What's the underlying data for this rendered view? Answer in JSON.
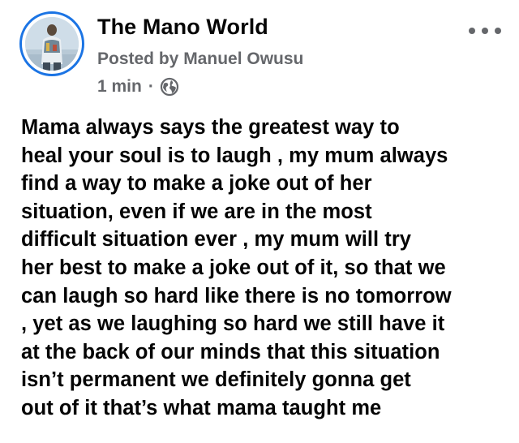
{
  "post": {
    "author_page": "The Mano World",
    "posted_by": "Posted by Manuel Owusu",
    "time": "1 min",
    "separator": "·",
    "privacy_icon": "globe-icon",
    "more_icon": "more-dots-icon",
    "avatar_icon": "profile-photo",
    "body": "Mama always says the greatest way to\nheal your soul is to laugh , my mum always\nfind a way to make a joke out of her\nsituation, even if we are in the most\ndifficult situation ever , my mum will try\nher best to make a joke out of it, so that we\ncan laugh so hard like there is no tomorrow\n, yet as we laughing so hard we still have it\nat the back of our minds that this situation\nisn’t permanent we definitely gonna get\nout of it that’s what mama taught me"
  },
  "colors": {
    "text_primary": "#050505",
    "text_secondary": "#65676b",
    "avatar_ring": "#1b74e4",
    "background": "#ffffff"
  }
}
